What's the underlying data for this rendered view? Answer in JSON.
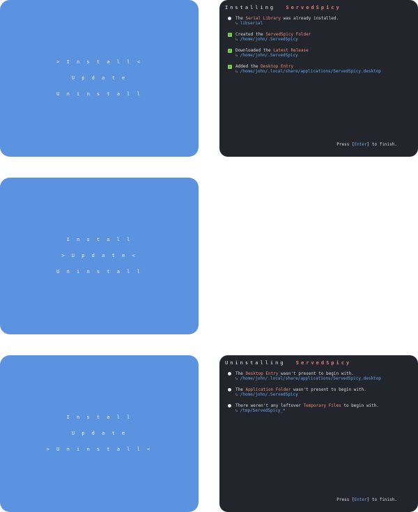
{
  "menu": {
    "install_selected": "> I n s t a l l <",
    "install": "I n s t a l l",
    "update_selected": "> U p d a t e <",
    "update": "U p d a t e",
    "uninstall_selected": "> U n i n s t a l l <",
    "uninstall": "U n i n s t a l l"
  },
  "install_terminal": {
    "title_prefix": "Installing",
    "title_app": "ServedSpicy",
    "entries": [
      {
        "icon": "bullet-icon",
        "pre": "The ",
        "highlight": "Serial Library",
        "post": " was already installed.",
        "path": "libserial"
      },
      {
        "icon": "check-icon",
        "pre": "Created the ",
        "highlight": "ServedSpicy Folder",
        "post": "",
        "path": "/home/john/.ServedSpicy"
      },
      {
        "icon": "check-icon",
        "pre": "Downloaded the ",
        "highlight": "Latest Release",
        "post": "",
        "path": "/home/john/.ServedSpicy"
      },
      {
        "icon": "check-icon",
        "pre": "Added the ",
        "highlight": "Desktop Entry",
        "post": "",
        "path": "/home/john/.local/share/applications/ServedSpicy.desktop"
      }
    ],
    "footer_pre": "Press [",
    "footer_key": "Enter",
    "footer_post": "] to finish."
  },
  "uninstall_terminal": {
    "title_prefix": "Uninstalling",
    "title_app": "ServedSpicy",
    "entries": [
      {
        "icon": "bullet-icon",
        "pre": "The ",
        "highlight": "Desktop Entry",
        "post": " wasn't present to begin with.",
        "path": "/home/john/.local/share/applications/ServedSpicy.desktop"
      },
      {
        "icon": "bullet-icon",
        "pre": "The ",
        "highlight": "Application Folder",
        "post": " wasn't present to begin with.",
        "path": "/home/john/.ServedSpicy"
      },
      {
        "icon": "bullet-icon",
        "pre": "There weren't any leftover ",
        "highlight": "Temporary Files",
        "post": " to begin with.",
        "path": "/tmp/ServedSpicy_*"
      }
    ],
    "footer_pre": "Press [",
    "footer_key": "Enter",
    "footer_post": "] to finish."
  },
  "colors": {
    "menu_bg": "#5b93e0",
    "terminal_bg": "#22262c",
    "accent_red": "#e47b7b",
    "path_blue": "#6aa2e8",
    "check_green": "#7fcf56"
  }
}
